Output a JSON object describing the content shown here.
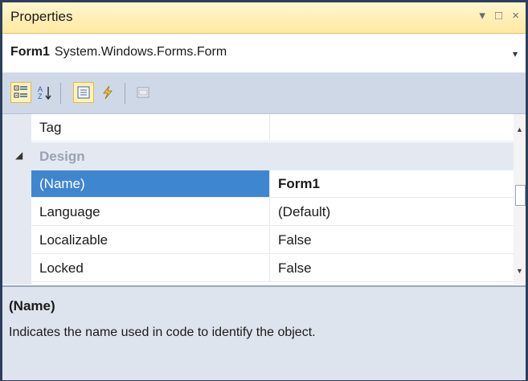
{
  "window": {
    "title": "Properties",
    "controls": "▾ □ ×"
  },
  "selector": {
    "object_name": "Form1",
    "object_type": "System.Windows.Forms.Form",
    "dropdown_glyph": "▾"
  },
  "toolbar": {
    "buttons": [
      {
        "icon": "categorized-icon",
        "active": true
      },
      {
        "icon": "alphabetical-icon",
        "active": false
      },
      {
        "icon": "properties-icon",
        "active": true
      },
      {
        "icon": "events-icon",
        "active": false
      },
      {
        "icon": "property-pages-icon",
        "active": false
      }
    ]
  },
  "grid": {
    "rows": [
      {
        "name": "Tag",
        "value": ""
      },
      {
        "category": "Design"
      },
      {
        "name": "(Name)",
        "value": "Form1",
        "selected": true
      },
      {
        "name": "Language",
        "value": "(Default)"
      },
      {
        "name": "Localizable",
        "value": "False"
      },
      {
        "name": "Locked",
        "value": "False"
      }
    ],
    "category_glyph": "◢"
  },
  "scrollbar": {
    "up": "▲",
    "down": "▼"
  },
  "description": {
    "name": "(Name)",
    "text": "Indicates the name used in code to identify the object."
  },
  "colors": {
    "title_bg": "#ffeba6",
    "toolbar_bg": "#cfd8e6",
    "selection": "#3f86d0",
    "category_text": "#9aa3b2"
  }
}
